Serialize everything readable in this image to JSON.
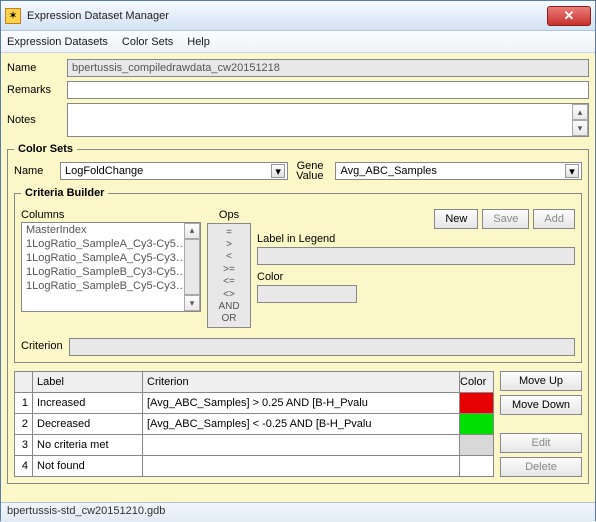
{
  "window": {
    "title": "Expression Dataset Manager"
  },
  "menu": {
    "datasets": "Expression Datasets",
    "colorsets": "Color Sets",
    "help": "Help"
  },
  "fields": {
    "name_lbl": "Name",
    "name_val": "bpertussis_compiledrawdata_cw20151218",
    "remarks_lbl": "Remarks",
    "notes_lbl": "Notes"
  },
  "colorsets": {
    "legend": "Color Sets",
    "name_lbl": "Name",
    "name_val": "LogFoldChange",
    "gene_lbl1": "Gene",
    "gene_lbl2": "Value",
    "gene_val": "Avg_ABC_Samples"
  },
  "cb": {
    "legend": "Criteria Builder",
    "cols_lbl": "Columns",
    "ops_lbl": "Ops",
    "cols": [
      "MasterIndex",
      "1LogRatio_SampleA_Cy3-Cy5…",
      "1LogRatio_SampleA_Cy5-Cy3…",
      "1LogRatio_SampleB_Cy3-Cy5…",
      "1LogRatio_SampleB_Cy5-Cy3…"
    ],
    "ops": [
      "=",
      ">",
      "<",
      ">=",
      "<=",
      "<>",
      "AND",
      "OR"
    ],
    "legend_lbl": "Label in Legend",
    "color_lbl": "Color",
    "new_btn": "New",
    "save_btn": "Save",
    "add_btn": "Add",
    "criterion_lbl": "Criterion"
  },
  "table": {
    "hdr_label": "Label",
    "hdr_crit": "Criterion",
    "hdr_color": "Color",
    "rows": [
      {
        "n": "1",
        "label": "Increased",
        "crit": "[Avg_ABC_Samples] > 0.25  AND [B-H_Pvalu",
        "color": "#e60000"
      },
      {
        "n": "2",
        "label": "Decreased",
        "crit": "[Avg_ABC_Samples] < -0.25 AND [B-H_Pvalu",
        "color": "#00e000"
      },
      {
        "n": "3",
        "label": "No criteria met",
        "crit": "",
        "color": "#d8d8d8"
      },
      {
        "n": "4",
        "label": "Not found",
        "crit": "",
        "color": "#ffffff"
      }
    ],
    "moveup": "Move Up",
    "movedown": "Move Down",
    "edit": "Edit",
    "delete": "Delete"
  },
  "status": {
    "file": "bpertussis-std_cw20151210.gdb"
  }
}
